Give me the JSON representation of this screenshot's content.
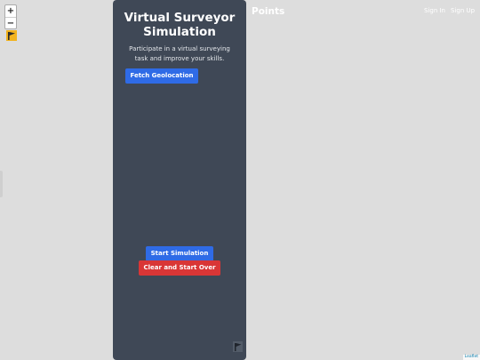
{
  "map": {
    "zoom_in_label": "+",
    "zoom_out_label": "−",
    "attribution": "Leaflet"
  },
  "panel": {
    "title": "Virtual Surveyor Simulation",
    "description": "Participate in a virtual surveying task and improve your skills.",
    "fetch_geolocation_label": "Fetch Geolocation",
    "start_simulation_label": "Start Simulation",
    "clear_start_over_label": "Clear and Start Over"
  },
  "header": {
    "brand": "Points",
    "sign_in": "Sign In",
    "sign_up": "Sign Up"
  },
  "colors": {
    "panel_bg": "#3f4856",
    "primary": "#2f6be6",
    "danger": "#d93636",
    "map_bg": "#dddddd"
  },
  "icons": {
    "map_marker": "flag-icon",
    "panel_corner": "flag-icon"
  }
}
